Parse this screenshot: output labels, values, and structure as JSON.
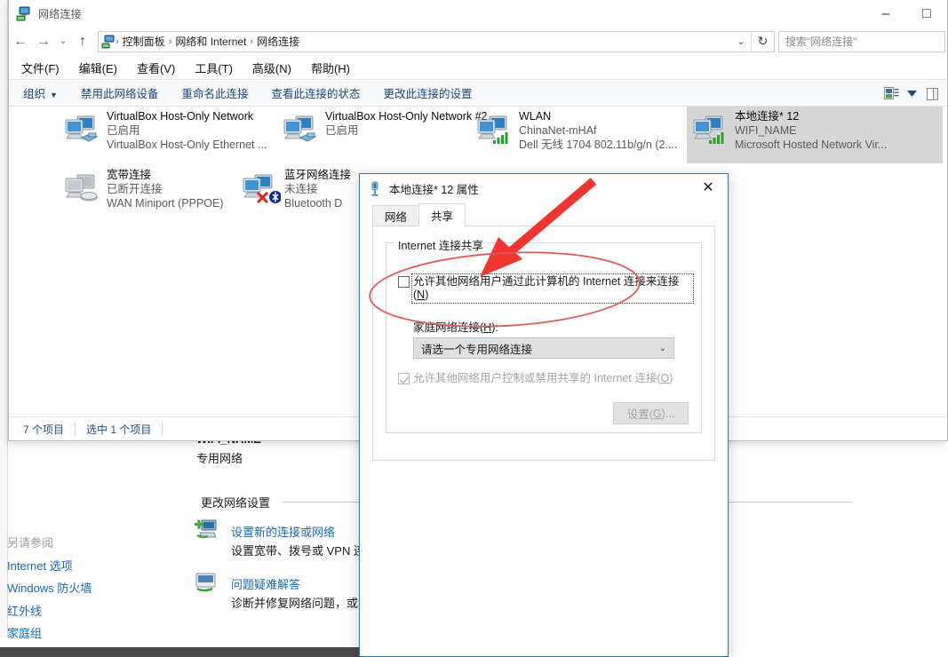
{
  "explorer": {
    "title": "网络连接",
    "title_icon": "network-connections-icon",
    "caption": {
      "minimize": "–",
      "maximize": "□"
    },
    "nav": {
      "back": "←",
      "forward": "→",
      "history": "⌄",
      "up": "↑"
    },
    "address": {
      "icon": "network-connections-icon",
      "crumbs": [
        "控制面板",
        "网络和 Internet",
        "网络连接"
      ],
      "separator": "›",
      "dropdown": "⌄",
      "refresh": "↻"
    },
    "search": {
      "placeholder": "搜索\"网络连接\""
    },
    "menubar": [
      "文件(F)",
      "编辑(E)",
      "查看(V)",
      "工具(T)",
      "高级(N)",
      "帮助(H)"
    ],
    "commandbar": {
      "organize": "组织",
      "organize_caret": "▼",
      "items": [
        "禁用此网络设备",
        "重命名此连接",
        "查看此连接的状态",
        "更改此连接的设置"
      ],
      "view_icon": "change-view-icon",
      "view_caret": "▼",
      "pane_icon": "preview-pane-icon"
    },
    "connections": [
      {
        "name": "VirtualBox Host-Only Network",
        "status": "已启用",
        "device": "VirtualBox Host-Only Ethernet ...",
        "icon": "lan-adapter-icon",
        "selected": false
      },
      {
        "name": "VirtualBox Host-Only Network #2",
        "status": "已启用",
        "device": "",
        "icon": "lan-adapter-icon",
        "selected": false
      },
      {
        "name": "WLAN",
        "status": "ChinaNet-mHAf",
        "device": "Dell 无线 1704 802.11b/g/n (2....",
        "icon": "wifi-adapter-icon",
        "selected": false
      },
      {
        "name": "本地连接* 12",
        "status": "WIFI_NAME",
        "device": "Microsoft Hosted Network Vir...",
        "icon": "wifi-adapter-icon",
        "selected": true
      },
      {
        "name": "宽带连接",
        "status": "已断开连接",
        "device": "WAN Miniport (PPPOE)",
        "icon": "dialup-adapter-icon",
        "selected": false
      },
      {
        "name": "蓝牙网络连接",
        "status": "未连接",
        "device": "Bluetooth D",
        "icon": "bluetooth-adapter-icon",
        "selected": false
      }
    ],
    "statusbar": {
      "count": "7 个项目",
      "selection": "选中 1 个项目"
    }
  },
  "sharing_center": {
    "wifi_name": "WIFI_NAME",
    "wifi_type": "专用网络",
    "section_title": "更改网络设置",
    "tasks": [
      {
        "link": "设置新的连接或网络",
        "desc": "设置宽带、拨号或 VPN 连",
        "icon": "new-connection-icon"
      },
      {
        "link": "问题疑难解答",
        "desc": "诊断并修复网络问题，或者",
        "icon": "troubleshoot-icon"
      }
    ],
    "see_also_header": "另请参阅",
    "see_also": [
      "Internet 选项",
      "Windows 防火墙",
      "红外线",
      "家庭组"
    ]
  },
  "dialog": {
    "title": "本地连接* 12 属性",
    "title_icon": "network-adapter-icon",
    "close": "✕",
    "tabs": [
      {
        "label": "网络",
        "active": false
      },
      {
        "label": "共享",
        "active": true
      }
    ],
    "group_label": "Internet 连接共享",
    "share_checkbox": {
      "checked": false,
      "label_pre": "允许其他网络用户通过此计算机的 Internet 连接来连接(",
      "accel": "N",
      "label_post": ")"
    },
    "home_network_label_pre": "家庭网络连接(",
    "home_network_accel": "H",
    "home_network_label_post": "):",
    "home_network_value": "请选一个专用网络连接",
    "home_network_arrow": "⌄",
    "control_checkbox": {
      "checked": true,
      "disabled": true,
      "label_pre": "允许其他网络用户控制或禁用共享的 Internet 连接(",
      "accel": "O",
      "label_post": ")"
    },
    "settings_button": {
      "label_pre": "设置(",
      "accel": "G",
      "label_post": ")...",
      "disabled": true
    }
  },
  "annotations": {
    "arrow_color": "#f0362f",
    "ellipse_color": "#e05a5a",
    "arrow_label": "red-arrow-pointing-to-share-checkbox",
    "ellipse_label": "red-ellipse-highlighting-share-checkbox"
  }
}
